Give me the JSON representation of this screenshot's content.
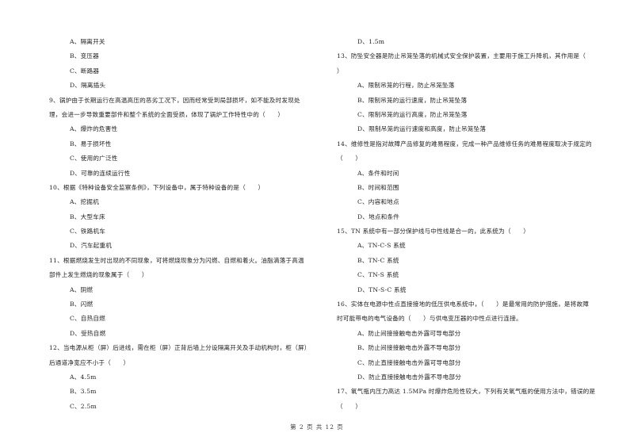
{
  "page": {
    "footer": "第 2 页 共 12 页"
  },
  "left_column": [
    {
      "type": "opt",
      "text": "A、隔离开关"
    },
    {
      "type": "opt",
      "text": "B、变压器"
    },
    {
      "type": "opt",
      "text": "C、断路器"
    },
    {
      "type": "opt",
      "text": "D、隔离插头"
    },
    {
      "type": "q",
      "text": "9、锅炉由于长期运行在高温高压的恶劣工况下，因而经常受到局部损坏，如不能及时发现处"
    },
    {
      "type": "q",
      "text": "理，会进一步导致重要部件和整个系统的全面受损，体现了锅炉工作特性中的（　　）"
    },
    {
      "type": "opt",
      "text": "A、爆炸的危害性"
    },
    {
      "type": "opt",
      "text": "B、易于损坏性"
    },
    {
      "type": "opt",
      "text": "C、使用的广泛性"
    },
    {
      "type": "opt",
      "text": "D、可靠的连续运行性"
    },
    {
      "type": "q",
      "text": "10、根据《特种设备安全监察条例》，下列设备中，属于特种设备的是（　　）"
    },
    {
      "type": "opt",
      "text": "A、挖掘机"
    },
    {
      "type": "opt",
      "text": "B、大型车床"
    },
    {
      "type": "opt",
      "text": "C、铁路机车"
    },
    {
      "type": "opt",
      "text": "D、汽车起重机"
    },
    {
      "type": "q",
      "text": "11、根据燃烧发生时出现的不同现象，可将燃烧现象分为闪燃、自燃和着火。油脂滴落于高温"
    },
    {
      "type": "q",
      "text": "部件上发生燃烧的现象属于（　　）"
    },
    {
      "type": "opt",
      "text": "A、阴燃"
    },
    {
      "type": "opt",
      "text": "B、闪燃"
    },
    {
      "type": "opt",
      "text": "C、自热自燃"
    },
    {
      "type": "opt",
      "text": "D、受热自燃"
    },
    {
      "type": "q",
      "text": "12、当电源从柜（屏）后进线，需在柜（屏）正背后墙上分设隔离开关及手动机构时，柜（屏）"
    },
    {
      "type": "q",
      "text": "后通道净宽应不小于（　　）"
    },
    {
      "type": "opt",
      "text": "A、4.5m"
    },
    {
      "type": "opt",
      "text": "B、3.5m"
    },
    {
      "type": "opt",
      "text": "C、2.5m"
    }
  ],
  "right_column": [
    {
      "type": "opt",
      "text": "D、1.5m"
    },
    {
      "type": "q",
      "text": "13、防坠安全器是防止吊笼坠落的机械式安全保护装置，主要用于施工升降机，其作用是（"
    },
    {
      "type": "q",
      "text": "）"
    },
    {
      "type": "opt",
      "text": "A、限制吊笼的行程，防止吊笼坠落"
    },
    {
      "type": "opt",
      "text": "B、限制吊笼的运行速度，防止吊笼坠落"
    },
    {
      "type": "opt",
      "text": "C、限制吊笼的运行高度，防止吊笼坠落"
    },
    {
      "type": "opt",
      "text": "D、限制吊笼的运行速度和高度，防止吊笼坠落"
    },
    {
      "type": "q",
      "text": "14、维修性是指对故障产品修复的难易程度，完成一种产品维修任务的难易程度取决于规定的"
    },
    {
      "type": "q",
      "text": "（　　）"
    },
    {
      "type": "opt",
      "text": "A、条件和时间"
    },
    {
      "type": "opt",
      "text": "B、时间和范围"
    },
    {
      "type": "opt",
      "text": "C、内容和地点"
    },
    {
      "type": "opt",
      "text": "D、地点和条件"
    },
    {
      "type": "q",
      "text": "15、TN 系统中有一部分保护线与中性线是合一的，此系统为（　　）"
    },
    {
      "type": "opt",
      "text": "A、TN-C-S 系统"
    },
    {
      "type": "opt",
      "text": "B、TN-C 系统"
    },
    {
      "type": "opt",
      "text": "C、TN-S 系统"
    },
    {
      "type": "opt",
      "text": "D、TN-S-C 系统"
    },
    {
      "type": "q",
      "text": "16、实体在电源中性点直接接地的低压供电系统中，（　　）是最常用的防护措施，是将故障"
    },
    {
      "type": "q",
      "text": "时可能带电的电气设备的（　　）与供电变压器的中性点进行连接。"
    },
    {
      "type": "opt",
      "text": "A、防止间接接触电击外露可导电部分"
    },
    {
      "type": "opt",
      "text": "B、防止间接接触电击外露不导电部分"
    },
    {
      "type": "opt",
      "text": "C、防止直接接触电击外露可导电部分"
    },
    {
      "type": "opt",
      "text": "D、防止直接接触电击外露不导电部分"
    },
    {
      "type": "q",
      "text": "17、氧气瓶内压力高达 1.5MPa 时爆炸危险性较大，下列有关氧气瓶的使用方法中，错误的是"
    },
    {
      "type": "q",
      "text": "（　　）"
    }
  ]
}
